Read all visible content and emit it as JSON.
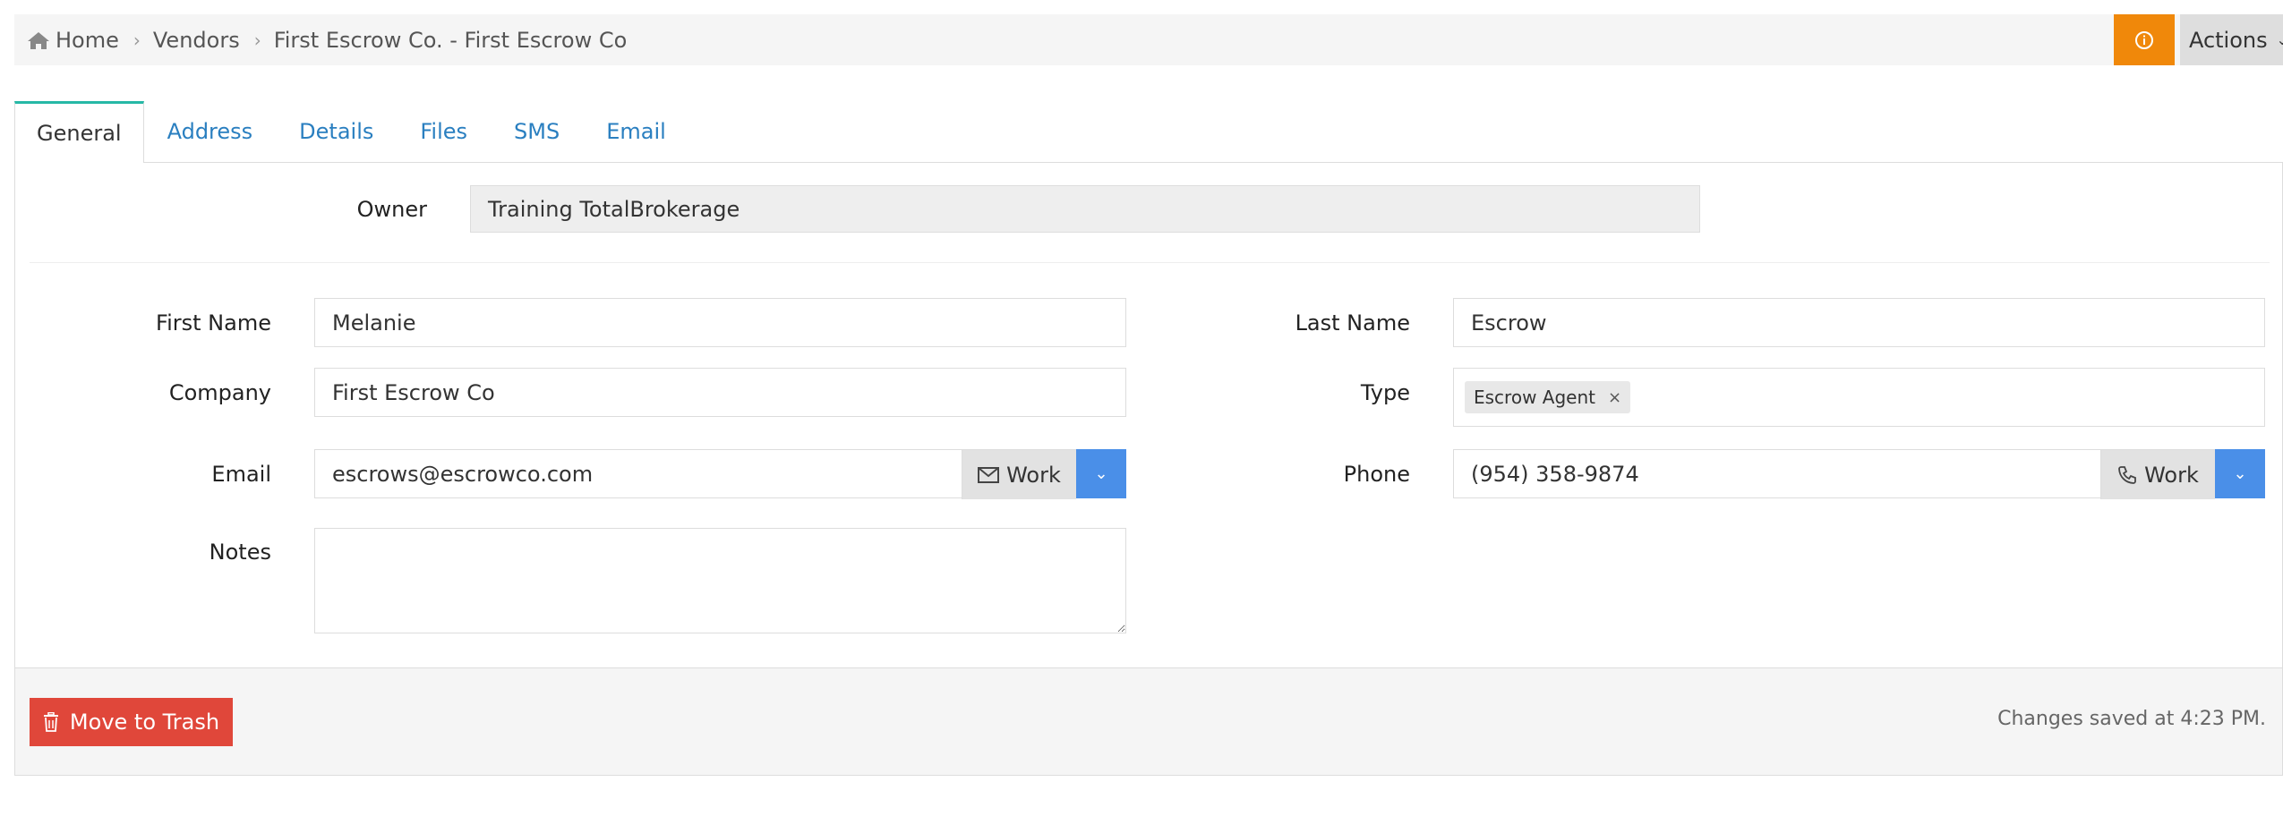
{
  "breadcrumb": {
    "items": [
      "Home",
      "Vendors",
      "First Escrow Co. - First Escrow Co"
    ]
  },
  "header": {
    "actions_label": "Actions",
    "info_icon": "info-circle-icon",
    "info_color": "#f0880a"
  },
  "tabs": [
    {
      "label": "General",
      "active": true
    },
    {
      "label": "Address"
    },
    {
      "label": "Details"
    },
    {
      "label": "Files"
    },
    {
      "label": "SMS"
    },
    {
      "label": "Email"
    }
  ],
  "form": {
    "owner": {
      "label": "Owner",
      "value": "Training TotalBrokerage"
    },
    "first_name": {
      "label": "First Name",
      "value": "Melanie"
    },
    "last_name": {
      "label": "Last Name",
      "value": "Escrow"
    },
    "company": {
      "label": "Company",
      "value": "First Escrow Co"
    },
    "type": {
      "label": "Type",
      "tags": [
        "Escrow Agent"
      ]
    },
    "email": {
      "label": "Email",
      "value": "escrows@escrowco.com",
      "kind": "Work"
    },
    "phone": {
      "label": "Phone",
      "value": "(954) 358-9874",
      "kind": "Work"
    },
    "notes": {
      "label": "Notes",
      "value": ""
    }
  },
  "footer": {
    "trash_label": "Move to Trash",
    "status": "Changes saved at 4:23 PM.",
    "trash_color": "#e0473a"
  },
  "colors": {
    "accent_blue": "#4a8fe8",
    "tab_active_border": "#26b8a6",
    "link": "#2a7fc0"
  }
}
